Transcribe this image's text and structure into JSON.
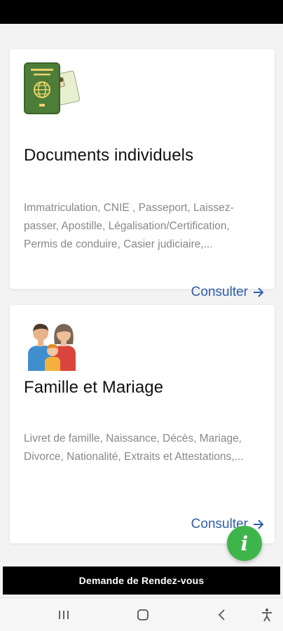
{
  "cards": [
    {
      "icon": "passport-id-icon",
      "title": "Documents individuels",
      "description": "Immatriculation, CNIE , Passeport, Laissez-passer, Apostille, Légalisation/Certification, Permis de conduire, Casier judiciaire,...",
      "link_label": "Consulter"
    },
    {
      "icon": "family-icon",
      "title": "Famille et Mariage",
      "description": "Livret de famille, Naissance, Décès, Mariage, Divorce, Nationalité, Extraits et Attestations,...",
      "link_label": "Consulter"
    }
  ],
  "fab": {
    "icon": "info-icon",
    "label": "i"
  },
  "bottom_button": {
    "label": "Demande de Rendez-vous"
  },
  "nav_bar": {
    "icons": [
      "recent-apps-icon",
      "home-icon",
      "back-icon",
      "accessibility-icon"
    ]
  },
  "colors": {
    "link": "#2f5ea8",
    "fab": "#3db54a",
    "passport": "#4a7a3a"
  }
}
